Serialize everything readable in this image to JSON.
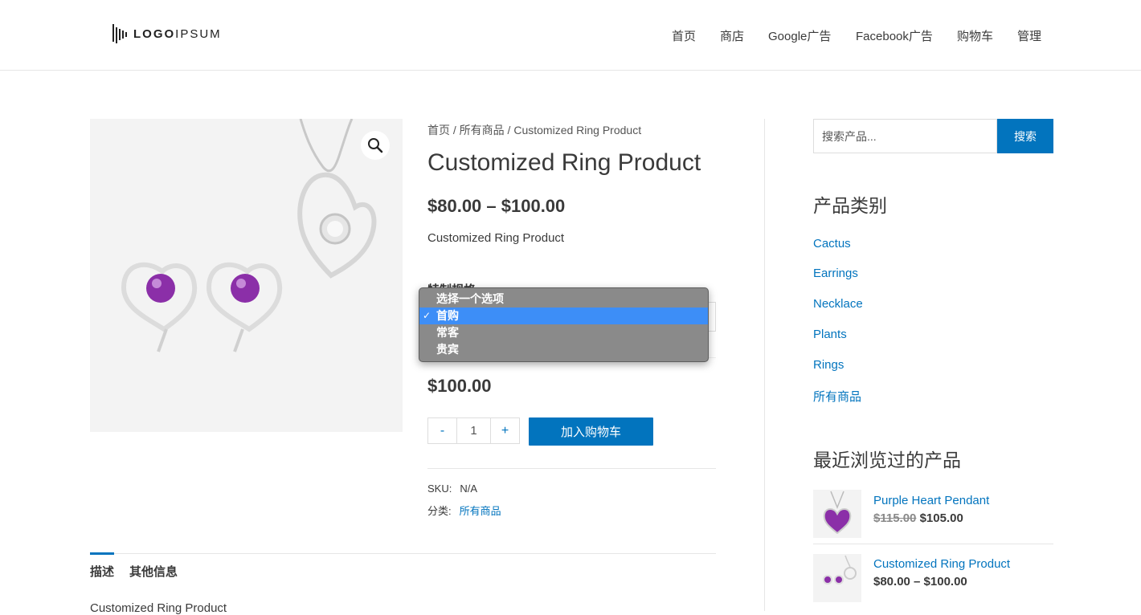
{
  "header": {
    "logo": {
      "bold": "LOGO",
      "rest": "IPSUM"
    },
    "nav": [
      "首页",
      "商店",
      "Google广告",
      "Facebook广告",
      "购物车",
      "管理"
    ]
  },
  "product": {
    "breadcrumb": {
      "home": "首页",
      "category": "所有商品",
      "sep": " / ",
      "current": "Customized Ring Product"
    },
    "title": "Customized Ring Product",
    "price_range": "$80.00 – $100.00",
    "short_description": "Customized Ring Product",
    "variation_label": "特制规格",
    "dropdown": {
      "options": [
        "选择一个选项",
        "首购",
        "常客",
        "贵宾"
      ],
      "selected": "首购"
    },
    "variation_price": "$100.00",
    "quantity": {
      "minus": "-",
      "value": "1",
      "plus": "+"
    },
    "add_to_cart": "加入购物车",
    "meta": {
      "sku_label": "SKU:",
      "sku_value": "N/A",
      "category_label": "分类:",
      "category_value": "所有商品"
    },
    "tabs": [
      "描述",
      "其他信息"
    ],
    "active_tab": "描述",
    "description": "Customized Ring Product",
    "zoom_icon": "magnifier-icon"
  },
  "sidebar": {
    "search": {
      "placeholder": "搜索产品...",
      "button": "搜索"
    },
    "categories_title": "产品类别",
    "categories": [
      "Cactus",
      "Earrings",
      "Necklace",
      "Plants",
      "Rings",
      "所有商品"
    ],
    "recent_title": "最近浏览过的产品",
    "recent": [
      {
        "name": "Purple Heart Pendant",
        "old_price": "$115.00",
        "price": "$105.00"
      },
      {
        "name": "Customized Ring Product",
        "price": "$80.00 – $100.00"
      }
    ]
  },
  "colors": {
    "accent": "#0274be",
    "text": "#3a3a3a",
    "dropdown_bg": "#8a8a8a",
    "dropdown_selected": "#3d8ef7",
    "gem": "#8b2fa8"
  }
}
